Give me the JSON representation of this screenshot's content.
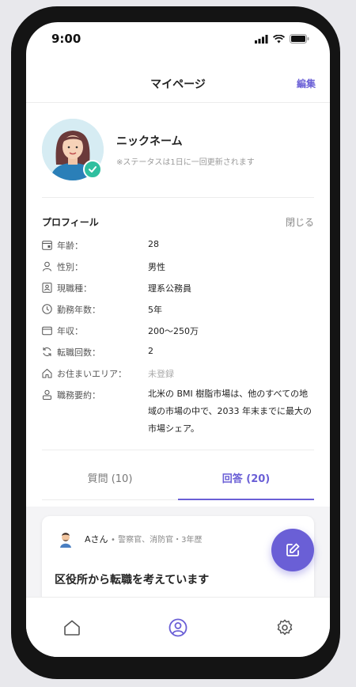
{
  "status_bar": {
    "time": "9:00"
  },
  "header": {
    "title": "マイページ",
    "edit_label": "編集"
  },
  "profile": {
    "nickname": "ニックネーム",
    "status_note": "※ステータスは1日に一回更新されます"
  },
  "profile_section": {
    "title": "プロフィール",
    "close_label": "閉じる",
    "rows": [
      {
        "icon": "calendar-icon",
        "label": "年齢：",
        "value": "28"
      },
      {
        "icon": "person-icon",
        "label": "性別：",
        "value": "男性"
      },
      {
        "icon": "id-card-icon",
        "label": "現職種：",
        "value": "理系公務員"
      },
      {
        "icon": "clock-icon",
        "label": "勤務年数：",
        "value": "5年"
      },
      {
        "icon": "wallet-icon",
        "label": "年収：",
        "value": "200〜250万"
      },
      {
        "icon": "refresh-icon",
        "label": "転職回数：",
        "value": "2"
      },
      {
        "icon": "home-icon",
        "label": "お住まいエリア：",
        "value": "未登録"
      },
      {
        "icon": "user-summary-icon",
        "label": "職務要約：",
        "value": "北米の BMI 樹脂市場は、他のすべての地域の市場の中で、2033 年末までに最大の市場シェア。"
      }
    ]
  },
  "tabs": [
    {
      "label": "質問 (10)",
      "active": false
    },
    {
      "label": "回答 (20)",
      "active": true
    }
  ],
  "card": {
    "user": "Aさん",
    "meta": "• 警察官、消防官・3年歴",
    "title": "区役所から転職を考えています"
  },
  "colors": {
    "accent": "#6a5fd6",
    "verified": "#2fbf9f"
  },
  "bottom_nav": [
    {
      "icon": "home-icon"
    },
    {
      "icon": "profile-icon"
    },
    {
      "icon": "settings-icon"
    }
  ]
}
